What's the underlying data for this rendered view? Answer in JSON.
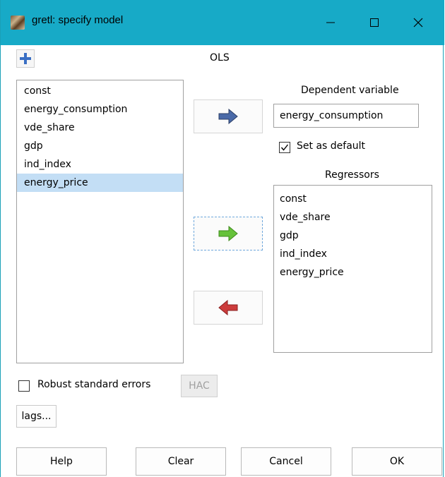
{
  "window": {
    "title": "gretl: specify model"
  },
  "header": {
    "estimator": "OLS"
  },
  "variables": {
    "items": [
      "const",
      "energy_consumption",
      "vde_share",
      "gdp",
      "ind_index",
      "energy_price"
    ],
    "selected": "energy_price"
  },
  "dependent": {
    "label": "Dependent variable",
    "value": "energy_consumption",
    "set_default_label": "Set as default",
    "set_default_checked": true
  },
  "regressors": {
    "label": "Regressors",
    "items": [
      "const",
      "vde_share",
      "gdp",
      "ind_index",
      "energy_price"
    ]
  },
  "options": {
    "robust_label": "Robust standard errors",
    "robust_checked": false,
    "hac_label": "HAC",
    "lags_label": "lags..."
  },
  "buttons": {
    "help": "Help",
    "clear": "Clear",
    "cancel": "Cancel",
    "ok": "OK"
  },
  "icons": {
    "add": "plus-icon",
    "dep_arrow": "arrow-right-blue-icon",
    "add_arrow": "arrow-right-green-icon",
    "remove_arrow": "arrow-left-red-icon"
  },
  "colors": {
    "titlebar": "#17aac7",
    "selection": "#c3def5",
    "blue_arrow": "#4a6aa8",
    "green_arrow": "#66c23a",
    "red_arrow": "#cc3c3c"
  }
}
